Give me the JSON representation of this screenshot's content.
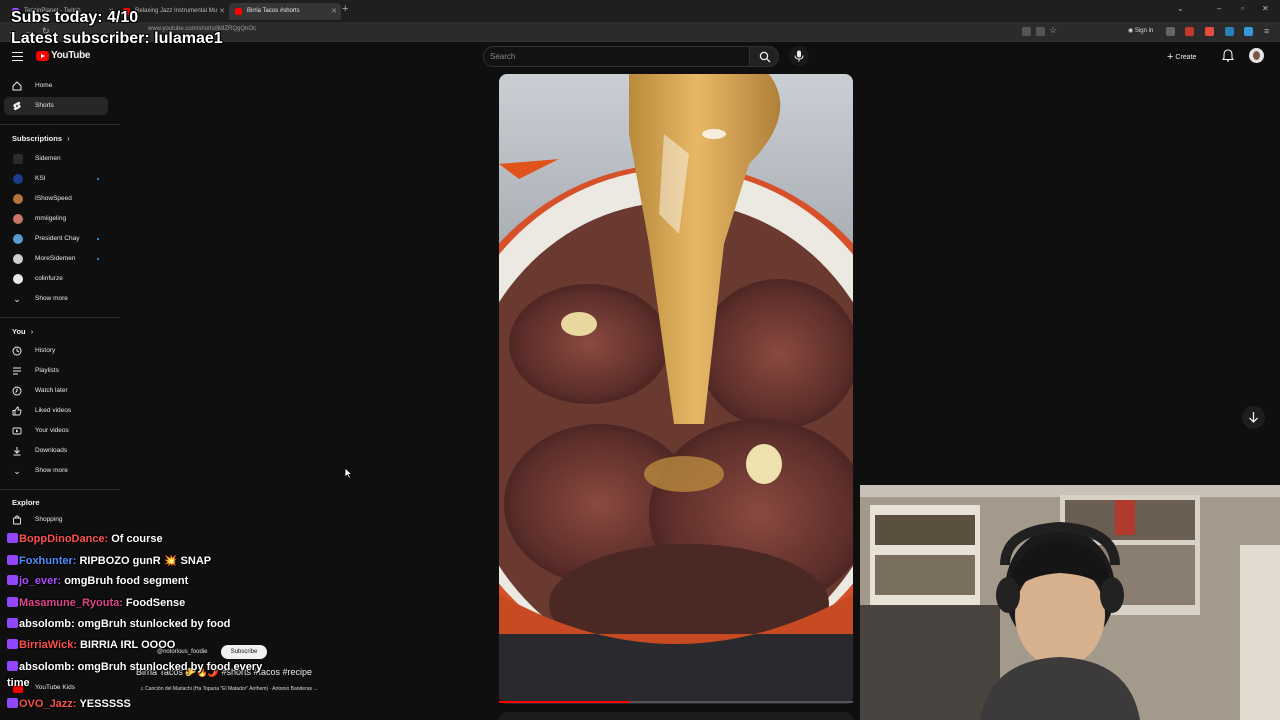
{
  "browser": {
    "tabs": [
      {
        "label": "TenzinPlanet - Twitch",
        "favicon_color": "#9146ff",
        "active": false
      },
      {
        "label": "Relaxing Jazz Instrumental Mu",
        "favicon_color": "#ff0000",
        "active": false
      },
      {
        "label": "Birria Tacos #shorts",
        "favicon_color": "#ff0000",
        "active": true
      }
    ],
    "url": "www.youtube.com/shorts/jMIZRQgQnOc",
    "signin": "Sign in"
  },
  "header": {
    "logo_text": "YouTube",
    "search_placeholder": "Search",
    "create_label": "Create"
  },
  "sidebar": {
    "main": [
      {
        "label": "Home",
        "icon": "home-icon",
        "active": false
      },
      {
        "label": "Shorts",
        "icon": "shorts-icon",
        "active": true
      }
    ],
    "subscriptions_heading": "Subscriptions",
    "subscriptions": [
      {
        "label": "Sidemen",
        "color": "#2b2b2b",
        "new": false
      },
      {
        "label": "KSI",
        "color": "#1a3d8f",
        "new": true
      },
      {
        "label": "IShowSpeed",
        "color": "#b6743a",
        "new": false
      },
      {
        "label": "mmiigeling",
        "color": "#c9776b",
        "new": false
      },
      {
        "label": "President Chay",
        "color": "#5a9ad0",
        "new": true
      },
      {
        "label": "MoreSidemen",
        "color": "#cfcfcf",
        "new": true
      },
      {
        "label": "colinfurze",
        "color": "#e9e9e9",
        "new": false
      }
    ],
    "subs_show_more": "Show more",
    "you_heading": "You",
    "you": [
      {
        "label": "History",
        "icon": "history-icon"
      },
      {
        "label": "Playlists",
        "icon": "playlists-icon"
      },
      {
        "label": "Watch later",
        "icon": "watch-later-icon"
      },
      {
        "label": "Liked videos",
        "icon": "liked-videos-icon"
      },
      {
        "label": "Your videos",
        "icon": "your-videos-icon"
      },
      {
        "label": "Downloads",
        "icon": "downloads-icon"
      }
    ],
    "you_show_more": "Show more",
    "explore_heading": "Explore",
    "explore": [
      {
        "label": "Shopping",
        "icon": "shopping-icon"
      }
    ],
    "youtube_kids": "YouTube Kids"
  },
  "short": {
    "channel": "@notorious_foodie",
    "subscribe_label": "Subscribe",
    "title": "Birria Tacos 🌮🔥🌶️ #shorts #tacos #recipe",
    "music": "♫ Canción del Mariachi (Ha Topuria \"El Matador\" Anthem) · Antonio Banderas ...",
    "progress": 0.37
  },
  "overlay": {
    "subs_today": "Subs today: 4/10",
    "latest_subscriber": "Latest subscriber: lulamae1"
  },
  "chat": [
    {
      "user": "BoppDinoDance:",
      "message": "Of course",
      "color": "#ff4f4f"
    },
    {
      "user": "Foxhunter:",
      "message": "RIPBOZO gunR 💥 SNAP",
      "color": "#4f8fff"
    },
    {
      "user": "jo_ever:",
      "message": "omgBruh food segment",
      "color": "#b04fff"
    },
    {
      "user": "Masamune_Ryouta:",
      "message": "FoodSense",
      "color": "#e0458b"
    },
    {
      "user": "absolomb:",
      "message": "omgBruh stunlocked by food",
      "color": "#ffffff"
    },
    {
      "user": "BirriaWick:",
      "message": "BIRRIA IRL OOOO",
      "color": "#ff4f4f"
    },
    {
      "user": "absolomb:",
      "message": "omgBruh stunlocked by food every",
      "color": "#ffffff"
    },
    {
      "user": "",
      "message": "time",
      "color": "#ffffff"
    },
    {
      "user": "OVO_Jazz:",
      "message": "YESSSSS",
      "color": "#ff4f4f"
    }
  ]
}
